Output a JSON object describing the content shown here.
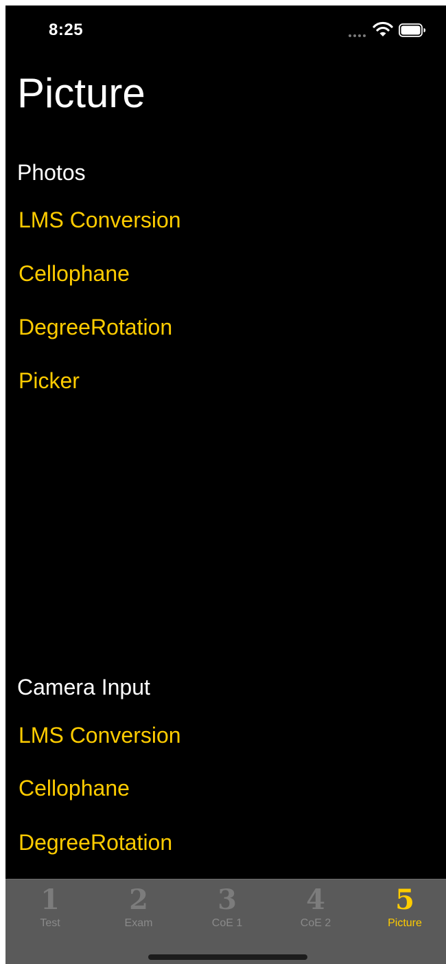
{
  "status_bar": {
    "time": "8:25",
    "signal_icon": "signal-dots-icon",
    "wifi_icon": "wifi-icon",
    "battery_icon": "battery-icon"
  },
  "page": {
    "title": "Picture"
  },
  "sections": {
    "photos": {
      "header": "Photos",
      "items": [
        "LMS Conversion",
        "Cellophane",
        "DegreeRotation",
        "Picker"
      ]
    },
    "camera": {
      "header": "Camera Input",
      "items": [
        "LMS Conversion",
        "Cellophane",
        "DegreeRotation"
      ]
    }
  },
  "tab_bar": {
    "tabs": [
      {
        "number": "1",
        "label": "Test"
      },
      {
        "number": "2",
        "label": "Exam"
      },
      {
        "number": "3",
        "label": "CoE 1"
      },
      {
        "number": "4",
        "label": "CoE 2"
      },
      {
        "number": "5",
        "label": "Picture"
      }
    ],
    "selected": "Picture"
  },
  "colors": {
    "background": "#000000",
    "accent": "#ffcc00",
    "tab_bar": "#5a5a5a",
    "tab_inactive": "#7c7c7c"
  }
}
